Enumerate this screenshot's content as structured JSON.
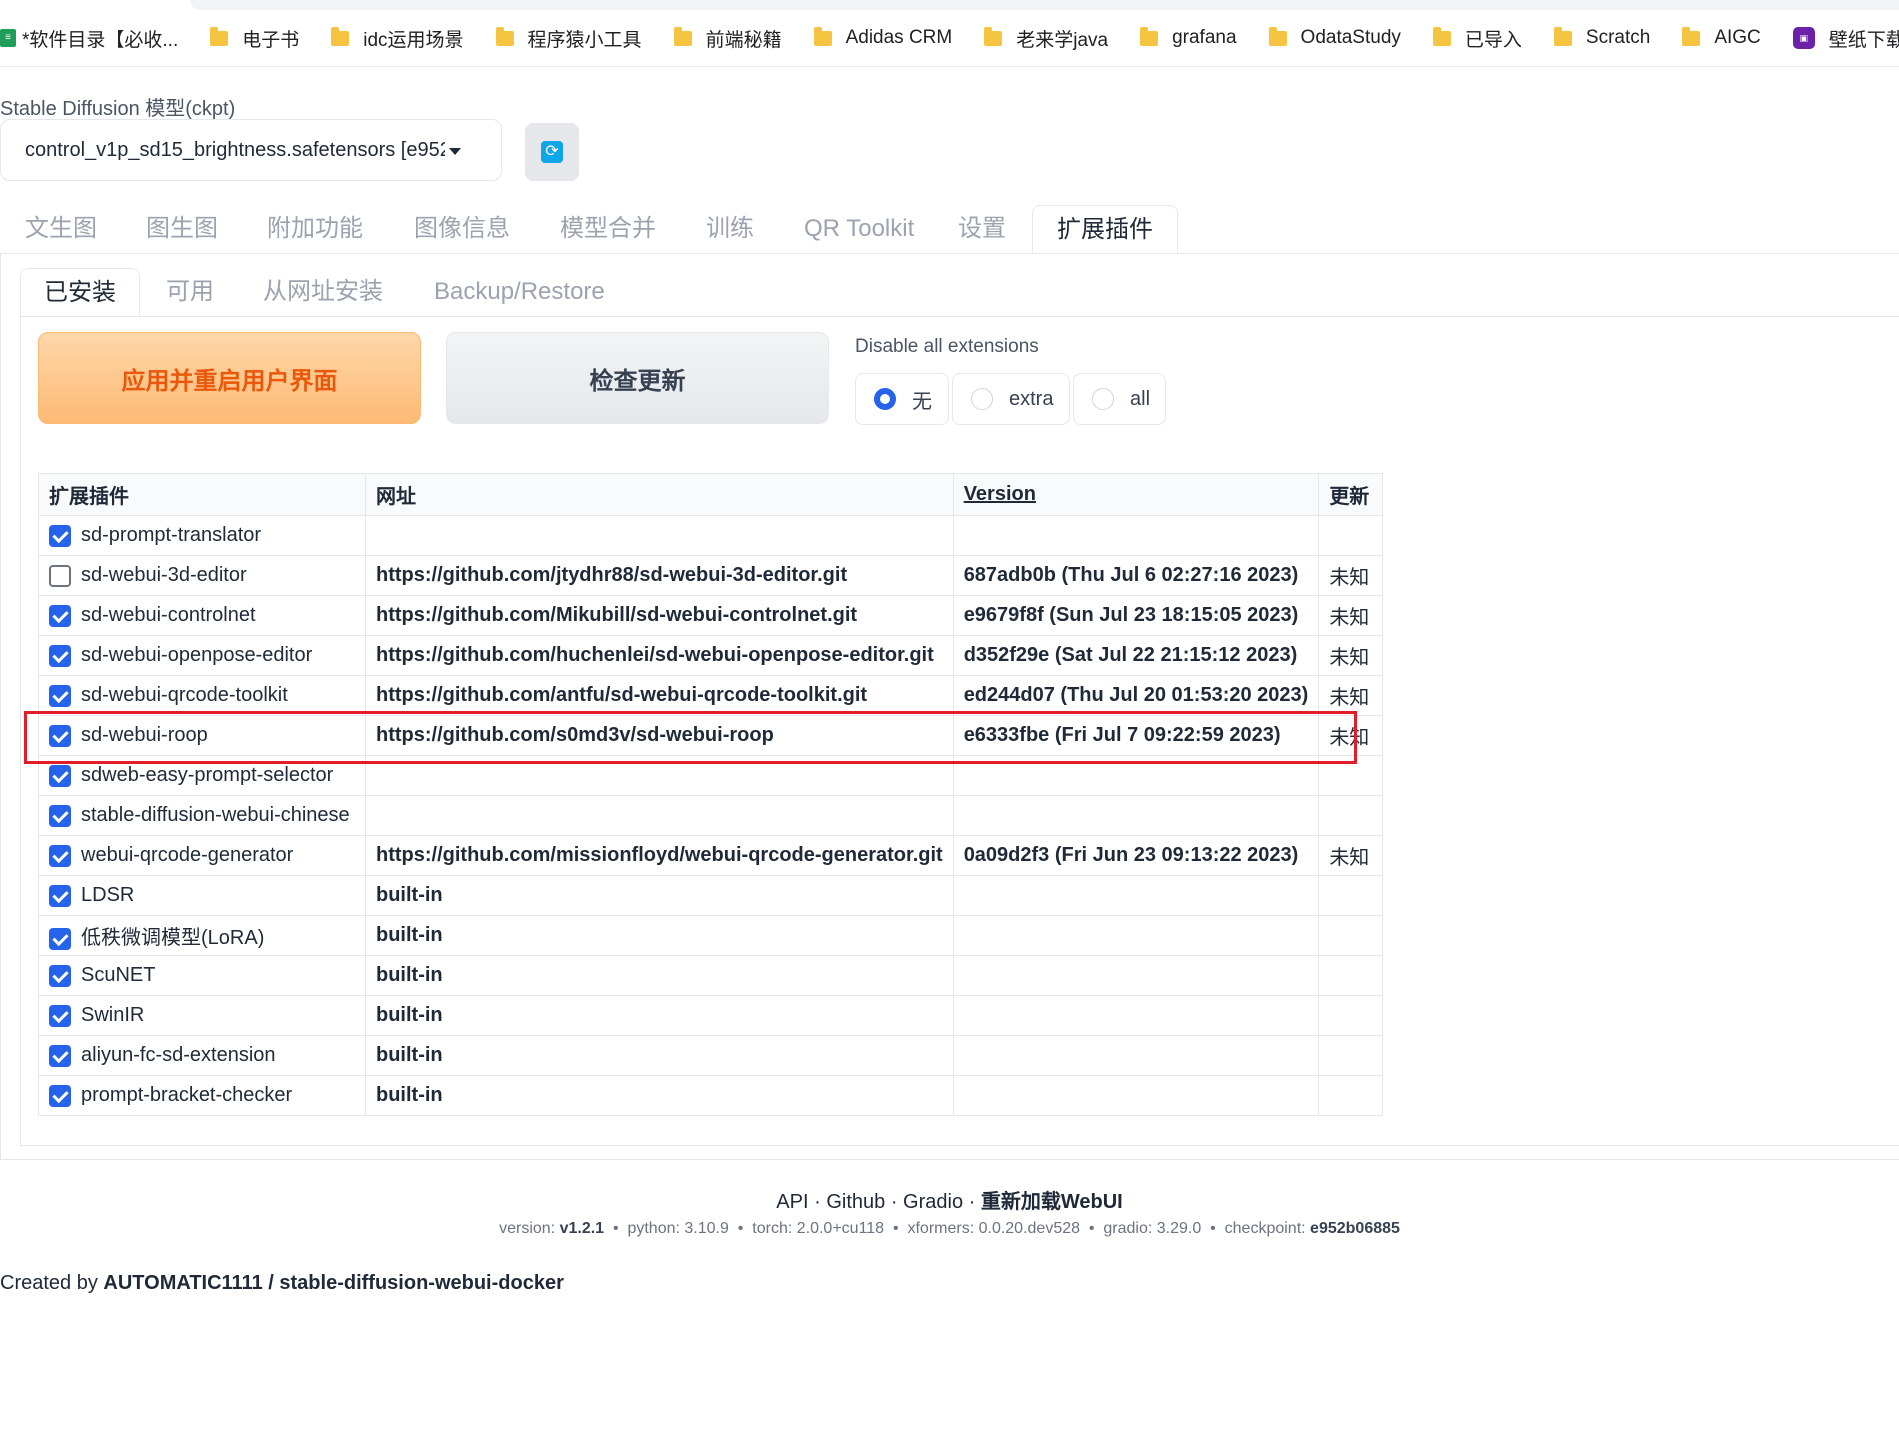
{
  "bookmarks": [
    {
      "label": "*软件目录【必收...",
      "icon": "sheet-icon"
    },
    {
      "label": "电子书",
      "icon": "folder-icon"
    },
    {
      "label": "idc运用场景",
      "icon": "folder-icon"
    },
    {
      "label": "程序猿小工具",
      "icon": "folder-icon"
    },
    {
      "label": "前端秘籍",
      "icon": "folder-icon"
    },
    {
      "label": "Adidas CRM",
      "icon": "folder-icon"
    },
    {
      "label": "老来学java",
      "icon": "folder-icon"
    },
    {
      "label": "grafana",
      "icon": "folder-icon"
    },
    {
      "label": "OdataStudy",
      "icon": "folder-icon"
    },
    {
      "label": "已导入",
      "icon": "folder-icon"
    },
    {
      "label": "Scratch",
      "icon": "folder-icon"
    },
    {
      "label": "AIGC",
      "icon": "folder-icon"
    },
    {
      "label": "壁纸下载",
      "icon": "app-icon"
    }
  ],
  "model": {
    "label": "Stable Diffusion 模型(ckpt)",
    "value": "control_v1p_sd15_brightness.safetensors [e952"
  },
  "main_tabs": [
    "文生图",
    "图生图",
    "附加功能",
    "图像信息",
    "模型合并",
    "训练",
    "QR Toolkit",
    "设置",
    "扩展插件"
  ],
  "sub_tabs": [
    "已安装",
    "可用",
    "从网址安装",
    "Backup/Restore"
  ],
  "actions": {
    "apply": "应用并重启用户界面",
    "check": "检查更新",
    "disable_label": "Disable all extensions",
    "radio_options": [
      "无",
      "extra",
      "all"
    ],
    "radio_selected": "无"
  },
  "table": {
    "headers": [
      "扩展插件",
      "网址",
      "Version",
      "更新"
    ],
    "rows": [
      {
        "name": "sd-prompt-translator",
        "checked": true,
        "url": "",
        "version": "",
        "update": ""
      },
      {
        "name": "sd-webui-3d-editor",
        "checked": false,
        "url": "https://github.com/jtydhr88/sd-webui-3d-editor.git",
        "version": "687adb0b (Thu Jul 6 02:27:16 2023)",
        "update": "未知"
      },
      {
        "name": "sd-webui-controlnet",
        "checked": true,
        "url": "https://github.com/Mikubill/sd-webui-controlnet.git",
        "version": "e9679f8f (Sun Jul 23 18:15:05 2023)",
        "update": "未知"
      },
      {
        "name": "sd-webui-openpose-editor",
        "checked": true,
        "url": "https://github.com/huchenlei/sd-webui-openpose-editor.git",
        "version": "d352f29e (Sat Jul 22 21:15:12 2023)",
        "update": "未知"
      },
      {
        "name": "sd-webui-qrcode-toolkit",
        "checked": true,
        "url": "https://github.com/antfu/sd-webui-qrcode-toolkit.git",
        "version": "ed244d07 (Thu Jul 20 01:53:20 2023)",
        "update": "未知"
      },
      {
        "name": "sd-webui-roop",
        "checked": true,
        "url": "https://github.com/s0md3v/sd-webui-roop",
        "version": "e6333fbe (Fri Jul 7 09:22:59 2023)",
        "update": "未知"
      },
      {
        "name": "sdweb-easy-prompt-selector",
        "checked": true,
        "url": "",
        "version": "",
        "update": ""
      },
      {
        "name": "stable-diffusion-webui-chinese",
        "checked": true,
        "url": "",
        "version": "",
        "update": ""
      },
      {
        "name": "webui-qrcode-generator",
        "checked": true,
        "url": "https://github.com/missionfloyd/webui-qrcode-generator.git",
        "version": "0a09d2f3 (Fri Jun 23 09:13:22 2023)",
        "update": "未知"
      },
      {
        "name": "LDSR",
        "checked": true,
        "url": "built-in",
        "version": "",
        "update": ""
      },
      {
        "name": "低秩微调模型(LoRA)",
        "checked": true,
        "url": "built-in",
        "version": "",
        "update": ""
      },
      {
        "name": "ScuNET",
        "checked": true,
        "url": "built-in",
        "version": "",
        "update": ""
      },
      {
        "name": "SwinIR",
        "checked": true,
        "url": "built-in",
        "version": "",
        "update": ""
      },
      {
        "name": "aliyun-fc-sd-extension",
        "checked": true,
        "url": "built-in",
        "version": "",
        "update": ""
      },
      {
        "name": "prompt-bracket-checker",
        "checked": true,
        "url": "built-in",
        "version": "",
        "update": ""
      }
    ]
  },
  "footer": {
    "links": [
      "API",
      "Github",
      "Gradio",
      "重新加载WebUI"
    ],
    "versions": [
      {
        "k": "version:",
        "v": "v1.2.1"
      },
      {
        "k": "python:",
        "v": "3.10.9"
      },
      {
        "k": "torch:",
        "v": "2.0.0+cu118"
      },
      {
        "k": "xformers:",
        "v": "0.0.20.dev528"
      },
      {
        "k": "gradio:",
        "v": "3.29.0"
      },
      {
        "k": "checkpoint:",
        "v": "e952b06885"
      }
    ],
    "created_prefix": "Created by",
    "created_by": "AUTOMATIC1111 / stable-diffusion-webui-docker"
  },
  "colors": {
    "accent": "#2563eb",
    "apply_text": "#ea580c",
    "highlight": "#e11d2a"
  }
}
